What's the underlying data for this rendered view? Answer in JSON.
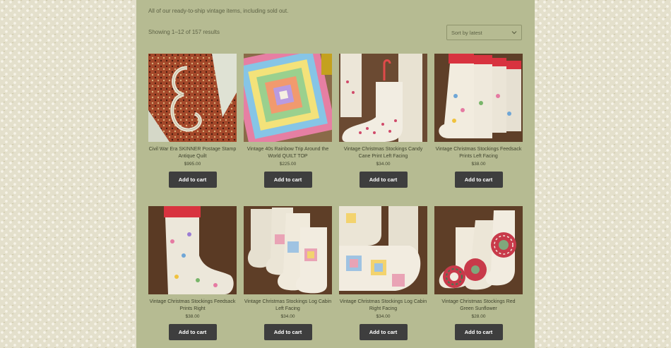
{
  "shop": {
    "intro": "All of our ready-to-ship vintage items, including sold out.",
    "result_count": "Showing 1–12 of 157 results",
    "sort_selected": "Sort by latest"
  },
  "products": [
    {
      "title": "Civil War Era SKINNER Postage Stamp Antique Quilt",
      "price": "$995.00",
      "button": "Add to cart"
    },
    {
      "title": "Vintage 40s Rainbow Trip Around the World QUILT TOP",
      "price": "$225.00",
      "button": "Add to cart"
    },
    {
      "title": "Vintage Christmas Stockings Candy Cane Print Left Facing",
      "price": "$34.00",
      "button": "Add to cart"
    },
    {
      "title": "Vintage Christmas Stockings Feedsack Prints Left Facing",
      "price": "$38.00",
      "button": "Add to cart"
    },
    {
      "title": "Vintage Christmas Stockings Feedsack Prints Right",
      "price": "$38.00",
      "button": "Add to cart"
    },
    {
      "title": "Vintage Christmas Stockings Log Cabin Left Facing",
      "price": "$34.00",
      "button": "Add to cart"
    },
    {
      "title": "Vintage Christmas Stockings Log Cabin Right Facing",
      "price": "$34.00",
      "button": "Add to cart"
    },
    {
      "title": "Vintage Christmas Stockings Red Green Sunflower",
      "price": "$28.00",
      "button": "Add to cart"
    }
  ],
  "colors": {
    "panel": "#b6bb92",
    "button": "#3e3e3e",
    "text": "#3f432d"
  },
  "icons": {
    "sort": "chevron-down-icon"
  }
}
